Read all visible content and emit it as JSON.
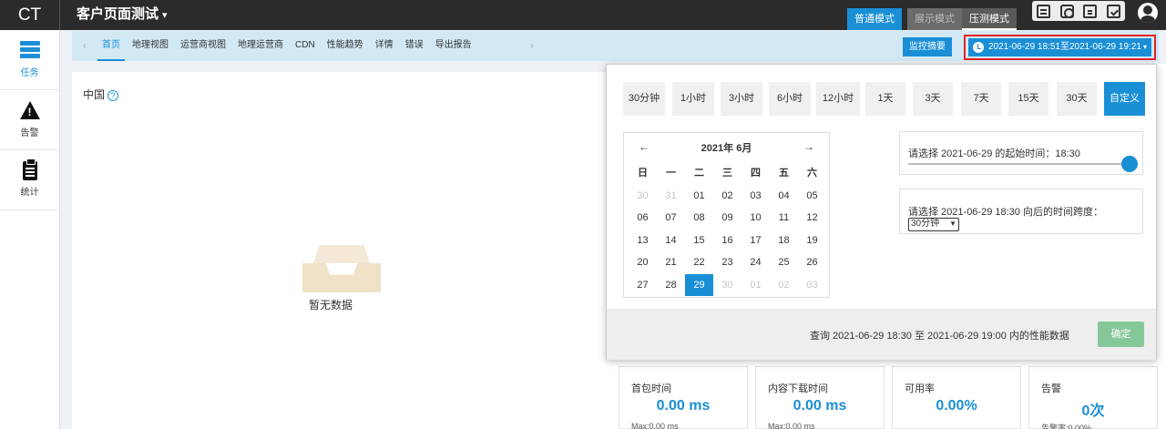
{
  "topbar": {
    "logo": "CT",
    "project_title": "客户页面测试",
    "project_caret": "▾",
    "modes": [
      "普通模式",
      "展示模式",
      "压测模式"
    ]
  },
  "sidebar": {
    "items": [
      {
        "label": "任务"
      },
      {
        "label": "告警"
      },
      {
        "label": "统计"
      }
    ]
  },
  "tabs": [
    "首页",
    "地理视图",
    "运营商视图",
    "地理运营商",
    "CDN",
    "性能趋势",
    "详情",
    "错误",
    "导出报告"
  ],
  "tab_arrows": {
    "left": "‹",
    "right": "›"
  },
  "toolbar": {
    "summary_label": "监控摘要",
    "time_range": "2021-06-29 18:51至2021-06-29 19:21",
    "time_caret": "▾"
  },
  "main": {
    "region_label": "中国",
    "help": "?",
    "empty_text": "暂无数据"
  },
  "stats": [
    {
      "label": "首包时间",
      "value": "0.00 ms",
      "sub": "Max:0.00 ms"
    },
    {
      "label": "内容下载时间",
      "value": "0.00 ms",
      "sub": "Max:0.00 ms"
    },
    {
      "label": "可用率",
      "value": "0.00%",
      "sub": ""
    },
    {
      "label": "告警",
      "value": "0次",
      "sub": "告警率:0.00%"
    }
  ],
  "popup": {
    "range_buttons": [
      "30分钟",
      "1小时",
      "3小时",
      "6小时",
      "12小时",
      "1天",
      "3天",
      "7天",
      "15天",
      "30天",
      "自定义"
    ],
    "active_range": "自定义",
    "calendar": {
      "month_title": "2021年 6月",
      "prev": "←",
      "next": "→",
      "weekdays": [
        "日",
        "一",
        "二",
        "三",
        "四",
        "五",
        "六"
      ],
      "weeks": [
        [
          "30",
          "31",
          "01",
          "02",
          "03",
          "04",
          "05"
        ],
        [
          "06",
          "07",
          "08",
          "09",
          "10",
          "11",
          "12"
        ],
        [
          "13",
          "14",
          "15",
          "16",
          "17",
          "18",
          "19"
        ],
        [
          "20",
          "21",
          "22",
          "23",
          "24",
          "25",
          "26"
        ],
        [
          "27",
          "28",
          "29",
          "30",
          "01",
          "02",
          "03"
        ]
      ],
      "selected": "29"
    },
    "start_label": "请选择 2021-06-29 的起始时间：18:30",
    "slider_fraction": 1.0,
    "span_label": "请选择 2021-06-29 18:30 向后的时间跨度：",
    "span_value": "30分钟",
    "footer_text": "查询 2021-06-29 18:30 至 2021-06-29 19:00 内的性能数据",
    "confirm_label": "确定"
  },
  "colors": {
    "accent": "#1a8fd6",
    "topbar": "#2b2b2b",
    "highlight_border": "#e52222",
    "confirm": "#86c79a"
  }
}
